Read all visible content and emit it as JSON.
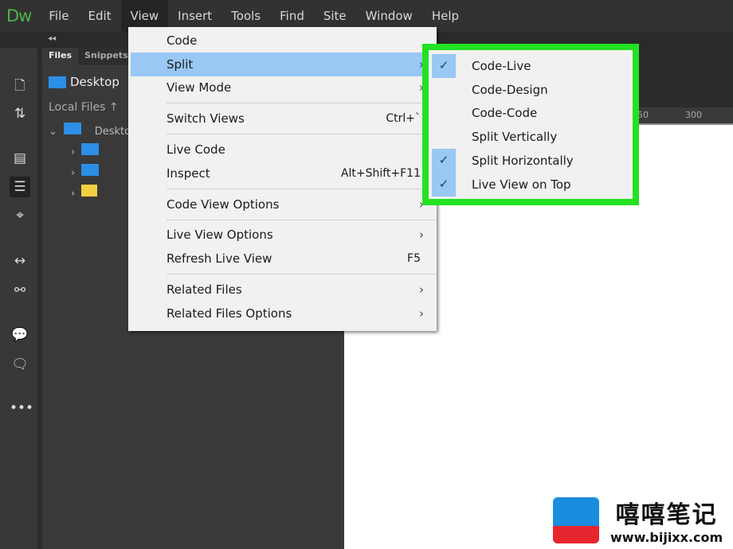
{
  "app": {
    "logo": "Dw"
  },
  "menubar": [
    "File",
    "Edit",
    "View",
    "Insert",
    "Tools",
    "Find",
    "Site",
    "Window",
    "Help"
  ],
  "panel": {
    "tabs": [
      "Files",
      "Snippets"
    ],
    "site": "Desktop",
    "local_files": "Local Files",
    "tree_root": "Desktop"
  },
  "ruler": {
    "ticks": [
      "50",
      "300"
    ]
  },
  "view_menu": {
    "items": [
      {
        "label": "Code"
      },
      {
        "label": "Split",
        "submenu": true,
        "highlighted": true
      },
      {
        "label": "View Mode",
        "submenu": true
      },
      {
        "sep": true
      },
      {
        "label": "Switch Views",
        "shortcut": "Ctrl+`"
      },
      {
        "sep": true
      },
      {
        "label": "Live Code"
      },
      {
        "label": "Inspect",
        "shortcut": "Alt+Shift+F11"
      },
      {
        "sep": true
      },
      {
        "label": "Code View Options",
        "submenu": true
      },
      {
        "sep": true
      },
      {
        "label": "Live View Options",
        "submenu": true
      },
      {
        "label": "Refresh Live View",
        "shortcut": "F5"
      },
      {
        "sep": true
      },
      {
        "label": "Related Files",
        "submenu": true
      },
      {
        "label": "Related Files Options",
        "submenu": true
      }
    ]
  },
  "split_submenu": [
    {
      "label": "Code-Live",
      "checked": true
    },
    {
      "label": "Code-Design",
      "checked": false
    },
    {
      "label": "Code-Code",
      "checked": false
    },
    {
      "label": "Split Vertically",
      "checked": false
    },
    {
      "label": "Split Horizontally",
      "checked": true
    },
    {
      "label": "Live View on Top",
      "checked": true
    }
  ],
  "highlight_color": "#22e222",
  "watermark": {
    "title": "嘻嘻笔记",
    "url": "www.bijixx.com"
  }
}
